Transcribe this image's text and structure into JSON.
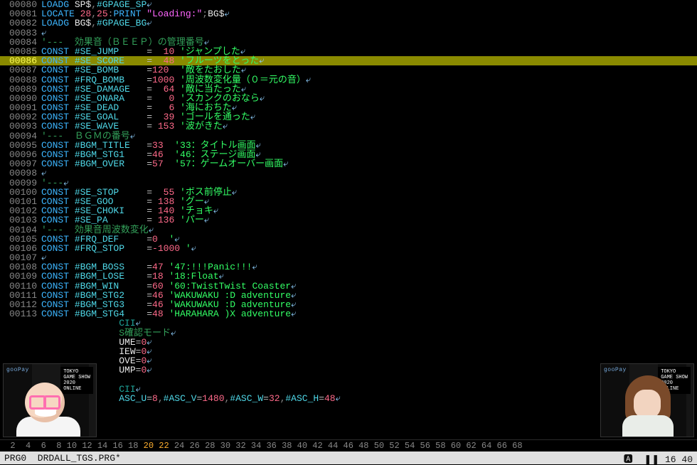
{
  "status": {
    "left": "PRG0  DRDALL_TGS.PRG*",
    "right": "🅰  ❚❚ 16 40"
  },
  "ruler": {
    "prefix": "  2  4  6  8 10 12 14 16 18 ",
    "current": "20 22",
    "suffix": " 24 26 28 30 32 34 36 38 40 42 44 46 48 50 52 54 56 58 60 62 64 66 68"
  },
  "event": {
    "brand": "gooPay",
    "l1": "TOKYO",
    "l2": "GAME SHOW",
    "l3": "2020",
    "l4": "ONLINE"
  },
  "lines": [
    {
      "n": "80",
      "hi": false,
      "t": [
        [
          "c-blue",
          "LOADG "
        ],
        [
          "c-white",
          "SP$"
        ],
        [
          "c-grey",
          ","
        ],
        [
          "c-cyan",
          "#GPAGE_SP"
        ],
        [
          "ret",
          "⤶"
        ]
      ]
    },
    {
      "n": "81",
      "hi": false,
      "t": [
        [
          "c-blue",
          "LOCATE "
        ],
        [
          "c-red",
          "28"
        ],
        [
          "c-grey",
          ","
        ],
        [
          "c-red",
          "25"
        ],
        [
          "c-grey",
          ":"
        ],
        [
          "c-blue",
          "PRINT "
        ],
        [
          "c-mag",
          "\"Loading:\""
        ],
        [
          "c-grey",
          ";"
        ],
        [
          "c-white",
          "BG$"
        ],
        [
          "ret",
          "⤶"
        ]
      ]
    },
    {
      "n": "82",
      "hi": false,
      "t": [
        [
          "c-blue",
          "LOADG "
        ],
        [
          "c-white",
          "BG$"
        ],
        [
          "c-grey",
          ","
        ],
        [
          "c-cyan",
          "#GPAGE_BG"
        ],
        [
          "ret",
          "⤶"
        ]
      ]
    },
    {
      "n": "83",
      "hi": false,
      "t": [
        [
          "ret",
          "⤶"
        ]
      ]
    },
    {
      "n": "84",
      "hi": false,
      "t": [
        [
          "c-dgrn",
          "'---  効果音（ＢＥＥＰ）の管理番号"
        ],
        [
          "ret",
          "⤶"
        ]
      ]
    },
    {
      "n": "85",
      "hi": false,
      "t": [
        [
          "c-blue",
          "CONST "
        ],
        [
          "c-cyan",
          "#SE_JUMP     "
        ],
        [
          "c-lgry",
          "=  "
        ],
        [
          "c-red",
          "10"
        ],
        [
          "c-green",
          " 'ジャンプした"
        ],
        [
          "ret",
          "⤶"
        ]
      ]
    },
    {
      "n": "86",
      "hi": true,
      "t": [
        [
          "c-blue",
          "CONST "
        ],
        [
          "c-cyan",
          "#SE_SCORE    "
        ],
        [
          "c-lgry",
          "=  "
        ],
        [
          "c-red",
          "48"
        ],
        [
          "c-green",
          " 'フルーツをとった"
        ],
        [
          "ret",
          "⤶"
        ]
      ]
    },
    {
      "n": "87",
      "hi": false,
      "t": [
        [
          "c-blue",
          "CONST "
        ],
        [
          "c-cyan",
          "#SE_BOMB     "
        ],
        [
          "c-lgry",
          "="
        ],
        [
          "c-red",
          "120 "
        ],
        [
          "c-green",
          " '敵をたおした"
        ],
        [
          "ret",
          "⤶"
        ]
      ]
    },
    {
      "n": "88",
      "hi": false,
      "t": [
        [
          "c-blue",
          "CONST "
        ],
        [
          "c-cyan",
          "#FRQ_BOMB    "
        ],
        [
          "c-lgry",
          "="
        ],
        [
          "c-red",
          "1000"
        ],
        [
          "c-green",
          " '周波数変化量（０＝元の音）"
        ],
        [
          "ret",
          "⤶"
        ]
      ]
    },
    {
      "n": "89",
      "hi": false,
      "t": [
        [
          "c-blue",
          "CONST "
        ],
        [
          "c-cyan",
          "#SE_DAMAGE   "
        ],
        [
          "c-lgry",
          "=  "
        ],
        [
          "c-red",
          "64"
        ],
        [
          "c-green",
          " '敵に当たった"
        ],
        [
          "ret",
          "⤶"
        ]
      ]
    },
    {
      "n": "90",
      "hi": false,
      "t": [
        [
          "c-blue",
          "CONST "
        ],
        [
          "c-cyan",
          "#SE_ONARA    "
        ],
        [
          "c-lgry",
          "=   "
        ],
        [
          "c-red",
          "0"
        ],
        [
          "c-green",
          " 'スカンクのおなら"
        ],
        [
          "ret",
          "⤶"
        ]
      ]
    },
    {
      "n": "91",
      "hi": false,
      "t": [
        [
          "c-blue",
          "CONST "
        ],
        [
          "c-cyan",
          "#SE_DEAD     "
        ],
        [
          "c-lgry",
          "=   "
        ],
        [
          "c-red",
          "6"
        ],
        [
          "c-green",
          " '海におちた"
        ],
        [
          "ret",
          "⤶"
        ]
      ]
    },
    {
      "n": "92",
      "hi": false,
      "t": [
        [
          "c-blue",
          "CONST "
        ],
        [
          "c-cyan",
          "#SE_GOAL     "
        ],
        [
          "c-lgry",
          "=  "
        ],
        [
          "c-red",
          "39"
        ],
        [
          "c-green",
          " 'ゴールを通った"
        ],
        [
          "ret",
          "⤶"
        ]
      ]
    },
    {
      "n": "93",
      "hi": false,
      "t": [
        [
          "c-blue",
          "CONST "
        ],
        [
          "c-cyan",
          "#SE_WAVE     "
        ],
        [
          "c-lgry",
          "= "
        ],
        [
          "c-red",
          "153"
        ],
        [
          "c-green",
          " '波がきた"
        ],
        [
          "ret",
          "⤶"
        ]
      ]
    },
    {
      "n": "94",
      "hi": false,
      "t": [
        [
          "c-dgrn",
          "'---  ＢＧＭの番号"
        ],
        [
          "ret",
          "⤶"
        ]
      ]
    },
    {
      "n": "95",
      "hi": false,
      "t": [
        [
          "c-blue",
          "CONST "
        ],
        [
          "c-cyan",
          "#BGM_TITLE   "
        ],
        [
          "c-lgry",
          "="
        ],
        [
          "c-red",
          "33"
        ],
        [
          "c-green",
          "  '33：タイトル画面"
        ],
        [
          "ret",
          "⤶"
        ]
      ]
    },
    {
      "n": "96",
      "hi": false,
      "t": [
        [
          "c-blue",
          "CONST "
        ],
        [
          "c-cyan",
          "#BGM_STG1    "
        ],
        [
          "c-lgry",
          "="
        ],
        [
          "c-red",
          "46"
        ],
        [
          "c-green",
          "  '46：ステージ画面"
        ],
        [
          "ret",
          "⤶"
        ]
      ]
    },
    {
      "n": "97",
      "hi": false,
      "t": [
        [
          "c-blue",
          "CONST "
        ],
        [
          "c-cyan",
          "#BGM_OVER    "
        ],
        [
          "c-lgry",
          "="
        ],
        [
          "c-red",
          "57"
        ],
        [
          "c-green",
          "  '57：ゲームオーバー画面"
        ],
        [
          "ret",
          "⤶"
        ]
      ]
    },
    {
      "n": "98",
      "hi": false,
      "t": [
        [
          "ret",
          "⤶"
        ]
      ]
    },
    {
      "n": "99",
      "hi": false,
      "t": [
        [
          "c-dgrn",
          "'---"
        ],
        [
          "ret",
          "⤶"
        ]
      ]
    },
    {
      "n": "100",
      "hi": false,
      "t": [
        [
          "c-blue",
          "CONST "
        ],
        [
          "c-cyan",
          "#SE_STOP     "
        ],
        [
          "c-lgry",
          "=  "
        ],
        [
          "c-red",
          "55"
        ],
        [
          "c-green",
          " 'ボス前停止"
        ],
        [
          "ret",
          "⤶"
        ]
      ]
    },
    {
      "n": "101",
      "hi": false,
      "t": [
        [
          "c-blue",
          "CONST "
        ],
        [
          "c-cyan",
          "#SE_GOO      "
        ],
        [
          "c-lgry",
          "= "
        ],
        [
          "c-red",
          "138"
        ],
        [
          "c-green",
          " 'グー"
        ],
        [
          "ret",
          "⤶"
        ]
      ]
    },
    {
      "n": "102",
      "hi": false,
      "t": [
        [
          "c-blue",
          "CONST "
        ],
        [
          "c-cyan",
          "#SE_CHOKI    "
        ],
        [
          "c-lgry",
          "= "
        ],
        [
          "c-red",
          "140"
        ],
        [
          "c-green",
          " 'チョキ"
        ],
        [
          "ret",
          "⤶"
        ]
      ]
    },
    {
      "n": "103",
      "hi": false,
      "t": [
        [
          "c-blue",
          "CONST "
        ],
        [
          "c-cyan",
          "#SE_PA       "
        ],
        [
          "c-lgry",
          "= "
        ],
        [
          "c-red",
          "136"
        ],
        [
          "c-green",
          " 'パー"
        ],
        [
          "ret",
          "⤶"
        ]
      ]
    },
    {
      "n": "104",
      "hi": false,
      "t": [
        [
          "c-dgrn",
          "'---  効果音周波数変化"
        ],
        [
          "ret",
          "⤶"
        ]
      ]
    },
    {
      "n": "105",
      "hi": false,
      "t": [
        [
          "c-blue",
          "CONST "
        ],
        [
          "c-cyan",
          "#FRQ_DEF     "
        ],
        [
          "c-lgry",
          "="
        ],
        [
          "c-red",
          "0 "
        ],
        [
          "c-green",
          " '"
        ],
        [
          "ret",
          "⤶"
        ]
      ]
    },
    {
      "n": "106",
      "hi": false,
      "t": [
        [
          "c-blue",
          "CONST "
        ],
        [
          "c-cyan",
          "#FRQ_STOP    "
        ],
        [
          "c-lgry",
          "="
        ],
        [
          "c-red",
          "-1000"
        ],
        [
          "c-green",
          " '"
        ],
        [
          "ret",
          "⤶"
        ]
      ]
    },
    {
      "n": "107",
      "hi": false,
      "t": [
        [
          "ret",
          "⤶"
        ]
      ]
    },
    {
      "n": "108",
      "hi": false,
      "t": [
        [
          "c-blue",
          "CONST "
        ],
        [
          "c-cyan",
          "#BGM_BOSS    "
        ],
        [
          "c-lgry",
          "="
        ],
        [
          "c-red",
          "47"
        ],
        [
          "c-green",
          " '47:!!!Panic!!!"
        ],
        [
          "ret",
          "⤶"
        ]
      ]
    },
    {
      "n": "109",
      "hi": false,
      "t": [
        [
          "c-blue",
          "CONST "
        ],
        [
          "c-cyan",
          "#BGM_LOSE    "
        ],
        [
          "c-lgry",
          "="
        ],
        [
          "c-red",
          "18"
        ],
        [
          "c-green",
          " '18:Float"
        ],
        [
          "ret",
          "⤶"
        ]
      ]
    },
    {
      "n": "110",
      "hi": false,
      "t": [
        [
          "c-blue",
          "CONST "
        ],
        [
          "c-cyan",
          "#BGM_WIN     "
        ],
        [
          "c-lgry",
          "="
        ],
        [
          "c-red",
          "60"
        ],
        [
          "c-green",
          " '60:TwistTwist Coaster"
        ],
        [
          "ret",
          "⤶"
        ]
      ]
    },
    {
      "n": "111",
      "hi": false,
      "t": [
        [
          "c-blue",
          "CONST "
        ],
        [
          "c-cyan",
          "#BGM_STG2    "
        ],
        [
          "c-lgry",
          "="
        ],
        [
          "c-red",
          "46"
        ],
        [
          "c-green",
          " 'WAKUWAKU :D adventure"
        ],
        [
          "ret",
          "⤶"
        ]
      ]
    },
    {
      "n": "112",
      "hi": false,
      "t": [
        [
          "c-blue",
          "CONST "
        ],
        [
          "c-cyan",
          "#BGM_STG3    "
        ],
        [
          "c-lgry",
          "="
        ],
        [
          "c-red",
          "46"
        ],
        [
          "c-green",
          " 'WAKUWAKU :D adventure"
        ],
        [
          "ret",
          "⤶"
        ]
      ]
    },
    {
      "n": "113",
      "hi": false,
      "t": [
        [
          "c-blue",
          "CONST "
        ],
        [
          "c-cyan",
          "#BGM_STG4    "
        ],
        [
          "c-lgry",
          "="
        ],
        [
          "c-red",
          "48"
        ],
        [
          "c-green",
          " 'HARAHARA )X adventure"
        ],
        [
          "ret",
          "⤶"
        ]
      ]
    },
    {
      "n": "",
      "hi": false,
      "t": [
        [
          "c-teal",
          "              CII"
        ],
        [
          "ret",
          "⤶"
        ]
      ]
    },
    {
      "n": "",
      "hi": false,
      "t": [
        [
          "c-dgrn",
          "              S確認モード"
        ],
        [
          "ret",
          "⤶"
        ]
      ]
    },
    {
      "n": "",
      "hi": false,
      "t": [
        [
          "c-white",
          "              UME"
        ],
        [
          "c-lgry",
          "="
        ],
        [
          "c-red",
          "0"
        ],
        [
          "ret",
          "⤶"
        ]
      ]
    },
    {
      "n": "",
      "hi": false,
      "t": [
        [
          "c-white",
          "              IEW"
        ],
        [
          "c-lgry",
          "="
        ],
        [
          "c-red",
          "0"
        ],
        [
          "ret",
          "⤶"
        ]
      ]
    },
    {
      "n": "",
      "hi": false,
      "t": [
        [
          "c-white",
          "              OVE"
        ],
        [
          "c-lgry",
          "="
        ],
        [
          "c-red",
          "0"
        ],
        [
          "ret",
          "⤶"
        ]
      ]
    },
    {
      "n": "",
      "hi": false,
      "t": [
        [
          "c-white",
          "              UMP"
        ],
        [
          "c-lgry",
          "="
        ],
        [
          "c-red",
          "0"
        ],
        [
          "ret",
          "⤶"
        ]
      ]
    },
    {
      "n": "",
      "hi": false,
      "t": [
        [
          "ret",
          "⤶"
        ]
      ]
    },
    {
      "n": "",
      "hi": false,
      "t": [
        [
          "c-teal",
          "              CII"
        ],
        [
          "ret",
          "⤶"
        ]
      ]
    },
    {
      "n": "",
      "hi": false,
      "t": [
        [
          "c-cyan",
          "              ASC_U"
        ],
        [
          "c-lgry",
          "="
        ],
        [
          "c-red",
          "8"
        ],
        [
          "c-grey",
          ","
        ],
        [
          "c-cyan",
          "#ASC_V"
        ],
        [
          "c-lgry",
          "="
        ],
        [
          "c-red",
          "1480"
        ],
        [
          "c-grey",
          ","
        ],
        [
          "c-cyan",
          "#ASC_W"
        ],
        [
          "c-lgry",
          "="
        ],
        [
          "c-red",
          "32"
        ],
        [
          "c-grey",
          ","
        ],
        [
          "c-cyan",
          "#ASC_H"
        ],
        [
          "c-lgry",
          "="
        ],
        [
          "c-red",
          "48"
        ],
        [
          "ret",
          "⤶"
        ]
      ]
    }
  ]
}
